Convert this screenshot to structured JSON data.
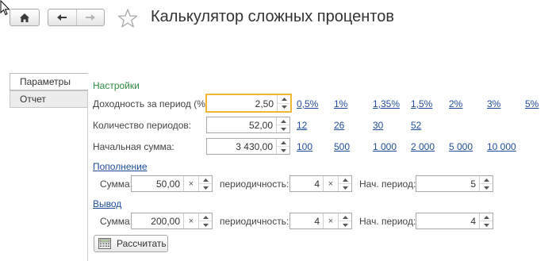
{
  "header": {
    "title": "Калькулятор сложных процентов"
  },
  "tabs": [
    "Параметры",
    "Отчет"
  ],
  "settings": {
    "section_label": "Настройки",
    "yield_label": "Доходность за период (%):",
    "yield_value": "2,50",
    "yield_options": [
      "0,5%",
      "1%",
      "1,35%",
      "1,5%",
      "2%",
      "3%",
      "5%"
    ],
    "periods_label": "Количество периодов:",
    "periods_value": "52,00",
    "periods_options": [
      "12",
      "26",
      "30",
      "52"
    ],
    "initial_label": "Начальная сумма:",
    "initial_value": "3 430,00",
    "initial_options": [
      "100",
      "500",
      "1 000",
      "2 000",
      "5 000",
      "10 000"
    ]
  },
  "deposit": {
    "section_label": "Пополнение",
    "sum_label": "Сумма:",
    "sum_value": "50,00",
    "period_label": "периодичность:",
    "period_value": "4",
    "start_label": "Нач. период:",
    "start_value": "5"
  },
  "withdraw": {
    "section_label": "Вывод",
    "sum_label": "Сумма:",
    "sum_value": "200,00",
    "period_label": "периодичность:",
    "period_value": "4",
    "start_label": "Нач. период:",
    "start_value": "4"
  },
  "actions": {
    "calculate_label": "Рассчитать"
  },
  "icons": {
    "home": "home-icon",
    "back": "arrow-left-icon",
    "forward": "arrow-right-icon",
    "favorite": "star-icon",
    "calculator": "calculator-icon"
  }
}
